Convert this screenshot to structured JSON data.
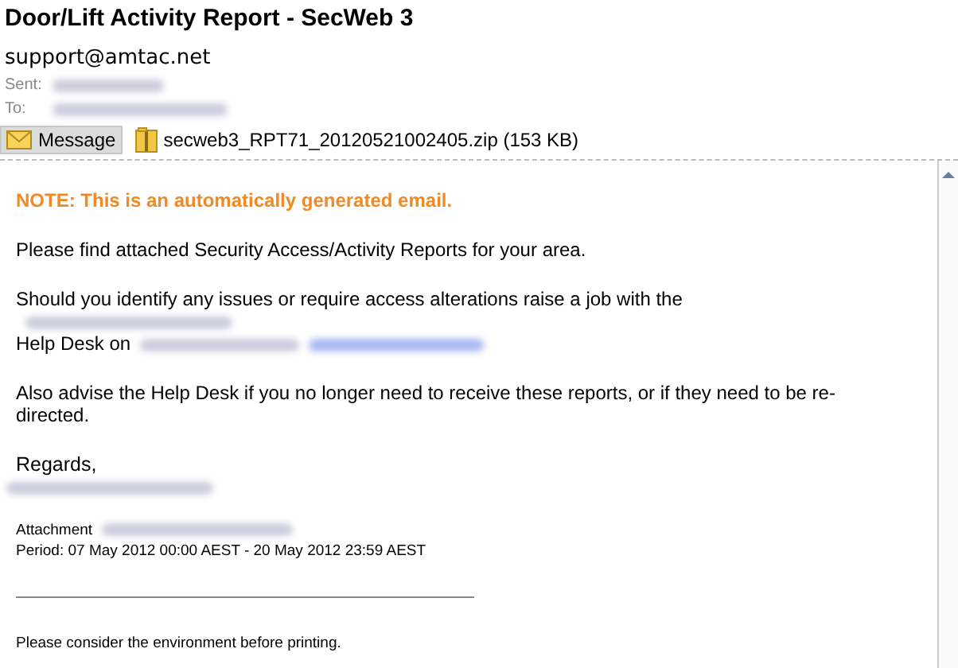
{
  "email": {
    "subject": "Door/Lift Activity Report - SecWeb 3",
    "sender": "support@amtac.net",
    "sent_label": "Sent:",
    "to_label": "To:"
  },
  "attachments": [
    {
      "kind": "message",
      "label": "Message",
      "selected": true
    },
    {
      "kind": "zip",
      "label": "secweb3_RPT71_20120521002405.zip (153 KB)",
      "selected": false
    }
  ],
  "body": {
    "note": "NOTE: This is an automatically generated email.",
    "para1": "Please find attached Security Access/Activity Reports for your area.",
    "para2_a": "Should you identify any issues or require access alterations raise a job with the",
    "para2_b": "Help Desk on",
    "para3": "Also advise the Help Desk if you no longer need to receive these reports, or if they need to be re-directed.",
    "regards": "Regards,",
    "attachment_label": "Attachment",
    "period": "Period: 07 May 2012 00:00 AEST - 20 May 2012 23:59 AEST",
    "footer": "Please consider the environment before printing."
  }
}
